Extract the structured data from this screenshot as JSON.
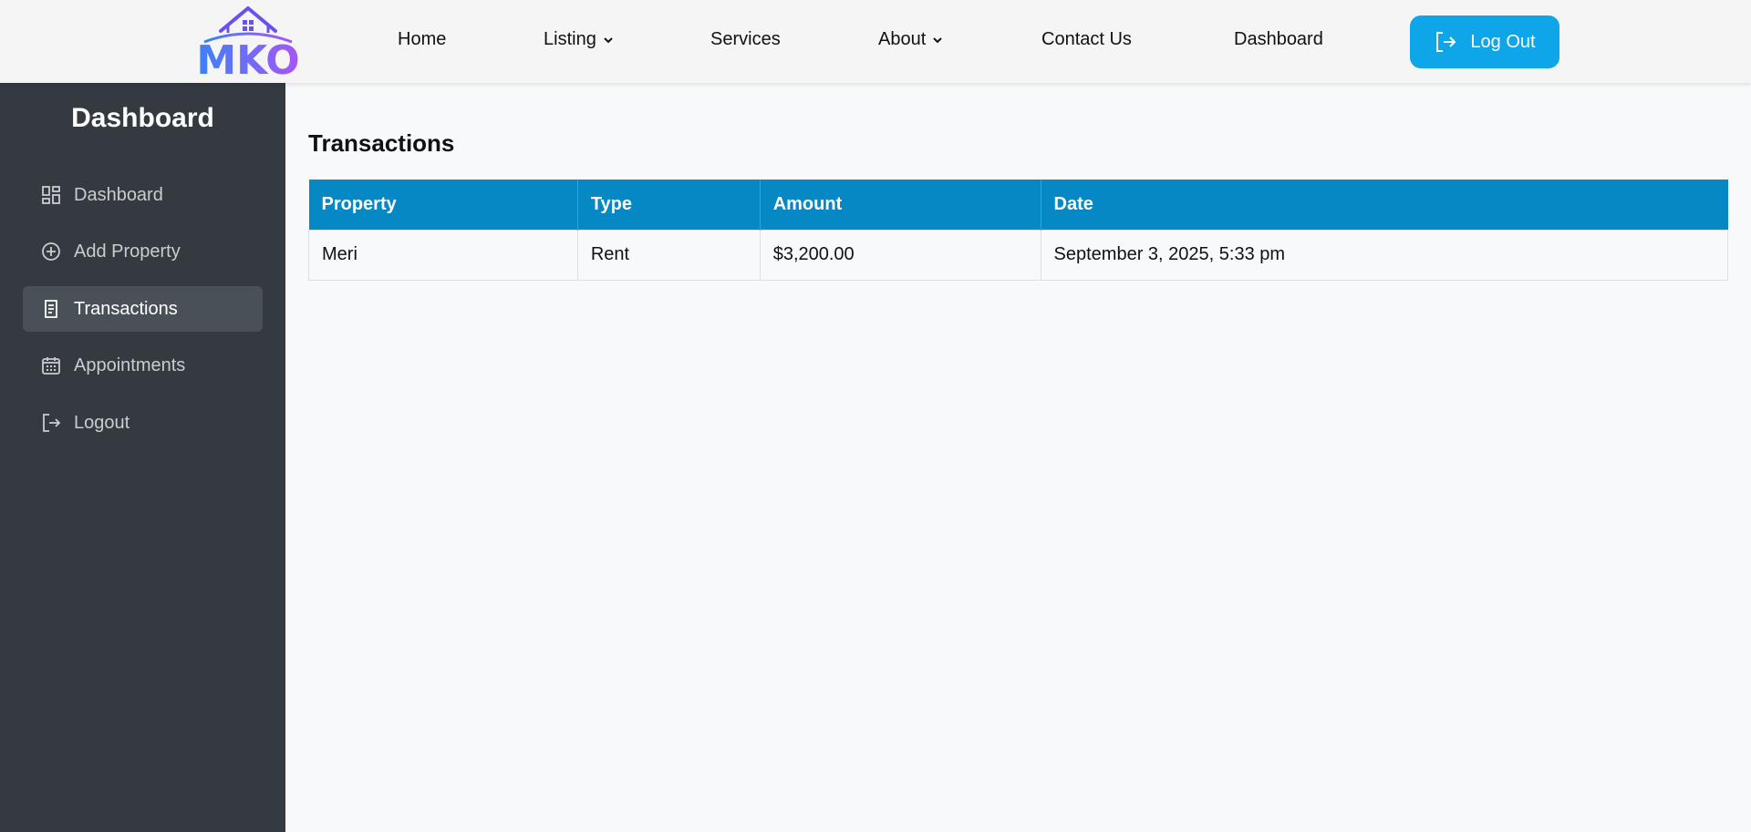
{
  "header": {
    "logo_text": "MKO",
    "nav": [
      {
        "label": "Home",
        "dropdown": false
      },
      {
        "label": "Listing",
        "dropdown": true
      },
      {
        "label": "Services",
        "dropdown": false
      },
      {
        "label": "About",
        "dropdown": true
      },
      {
        "label": "Contact Us",
        "dropdown": false
      },
      {
        "label": "Dashboard",
        "dropdown": false
      }
    ],
    "logout_label": "Log Out",
    "logout_color": "#0ea5e9"
  },
  "sidebar": {
    "title": "Dashboard",
    "items": [
      {
        "label": "Dashboard",
        "icon": "dashboard-grid-icon",
        "active": false
      },
      {
        "label": "Add Property",
        "icon": "plus-circle-icon",
        "active": false
      },
      {
        "label": "Transactions",
        "icon": "receipt-icon",
        "active": true
      },
      {
        "label": "Appointments",
        "icon": "calendar-icon",
        "active": false
      },
      {
        "label": "Logout",
        "icon": "logout-icon",
        "active": false
      }
    ]
  },
  "main": {
    "title": "Transactions",
    "table": {
      "headers": [
        "Property",
        "Type",
        "Amount",
        "Date"
      ],
      "rows": [
        [
          "Meri",
          "Rent",
          "$3,200.00",
          "September 3, 2025, 5:33 pm"
        ]
      ],
      "header_color": "#0588c4"
    }
  }
}
